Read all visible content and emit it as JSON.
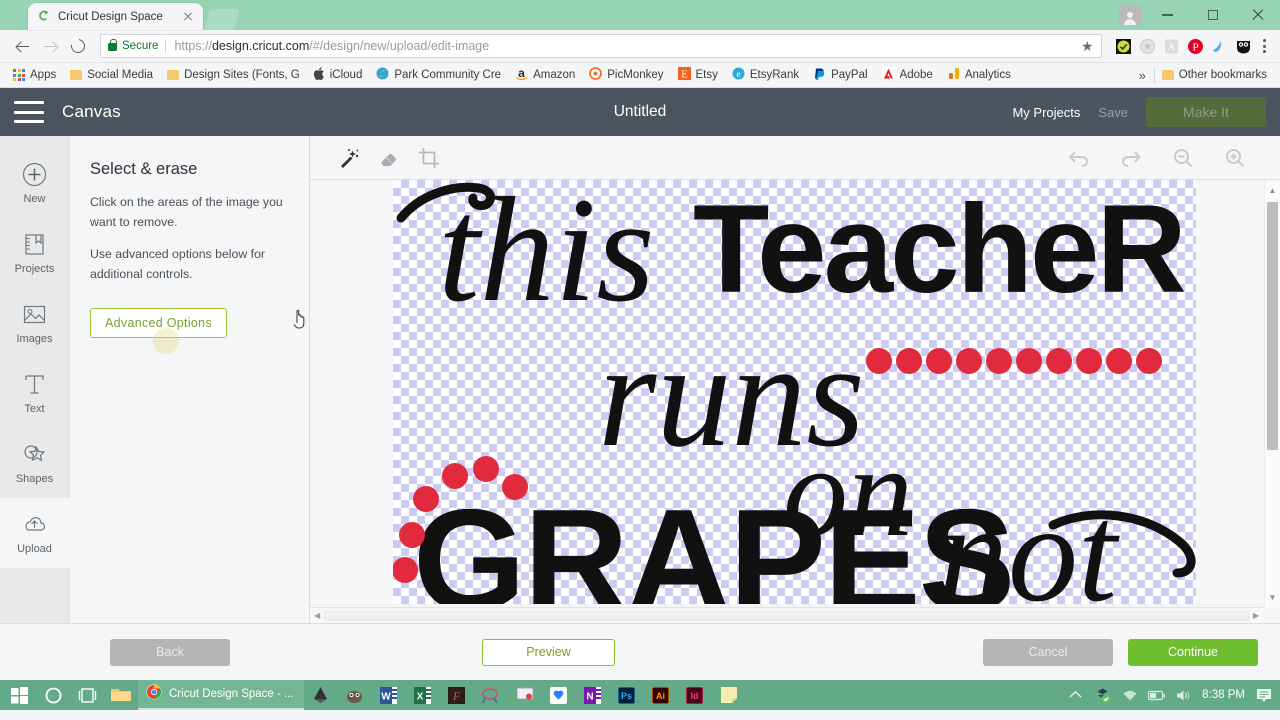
{
  "browser": {
    "tab": {
      "title": "Cricut Design Space",
      "favicon": "cricut-favicon",
      "close": "close-icon"
    },
    "new_tab_label": "",
    "window_controls": {
      "minimize": "minimize-icon",
      "maximize": "maximize-icon",
      "close": "close-icon"
    },
    "nav": {
      "back": "back-arrow-icon",
      "forward": "forward-arrow-icon",
      "reload": "reload-icon"
    },
    "address": {
      "security_label": "Secure",
      "url_prefix": "https://",
      "url_domain": "design.cricut.com",
      "url_path": "/#/design/new/upload/edit-image",
      "full_url": "https://design.cricut.com/#/design/new/upload/edit-image",
      "bookmark_star": "★"
    },
    "extensions": [
      "checkmark-extension-icon",
      "circle-extension-icon",
      "pdf-extension-icon",
      "pinterest-icon",
      "swoosh-extension-icon",
      "owl-extension-icon"
    ],
    "menu": "kebab-menu-icon",
    "bookmarks": [
      {
        "label": "Apps",
        "icon": "apps-grid-icon"
      },
      {
        "label": "Social Media",
        "icon": "folder-icon"
      },
      {
        "label": "Design Sites (Fonts, G",
        "icon": "folder-icon"
      },
      {
        "label": "iCloud",
        "icon": "apple-icon"
      },
      {
        "label": "Park Community Cre",
        "icon": "park-community-icon"
      },
      {
        "label": "Amazon",
        "icon": "amazon-icon"
      },
      {
        "label": "PicMonkey",
        "icon": "picmonkey-icon"
      },
      {
        "label": "Etsy",
        "icon": "etsy-icon"
      },
      {
        "label": "EtsyRank",
        "icon": "etsyrank-icon"
      },
      {
        "label": "PayPal",
        "icon": "paypal-icon"
      },
      {
        "label": "Adobe",
        "icon": "adobe-icon"
      },
      {
        "label": "Analytics",
        "icon": "analytics-icon"
      }
    ],
    "bookmarks_overflow": "»",
    "other_bookmarks": {
      "label": "Other bookmarks",
      "icon": "folder-icon"
    }
  },
  "app": {
    "menu_icon": "hamburger-menu-icon",
    "title": "Canvas",
    "document_title": "Untitled",
    "my_projects": "My Projects",
    "save": "Save",
    "make_it": "Make It"
  },
  "sidebar": {
    "items": [
      {
        "label": "New",
        "icon": "plus-circle-icon",
        "active": false
      },
      {
        "label": "Projects",
        "icon": "projects-book-icon",
        "active": false
      },
      {
        "label": "Images",
        "icon": "image-photo-icon",
        "active": false
      },
      {
        "label": "Text",
        "icon": "text-t-icon",
        "active": false
      },
      {
        "label": "Shapes",
        "icon": "shapes-star-icon",
        "active": false
      },
      {
        "label": "Upload",
        "icon": "upload-cloud-icon",
        "active": true
      }
    ]
  },
  "panel": {
    "heading": "Select & erase",
    "paragraph1": "Click on the areas of the image you want to remove.",
    "paragraph2": "Use advanced options below for additional controls.",
    "advanced_button": "Advanced Options"
  },
  "editor_toolbar": {
    "tools": [
      {
        "name": "magic-wand-icon",
        "active": true
      },
      {
        "name": "eraser-icon",
        "active": false
      },
      {
        "name": "crop-icon",
        "active": false
      }
    ],
    "right_tools": [
      {
        "name": "undo-icon"
      },
      {
        "name": "redo-icon"
      },
      {
        "name": "zoom-out-icon"
      },
      {
        "name": "zoom-in-icon"
      }
    ]
  },
  "artwork": {
    "description": "this TeacheR runs on GRAPES not",
    "lines": [
      "this TeacheR",
      "runs",
      "on",
      "GRAPES not"
    ],
    "dot_color": "#e12a3e",
    "ink_color": "#111111",
    "checker_color": "#ccccf0",
    "top_dot_row_count": 10,
    "arc_dot_count": 6
  },
  "scrollbars": {
    "vertical": {
      "up_arrow": "scroll-up-arrow-icon",
      "down_arrow": "scroll-down-arrow-icon"
    },
    "horizontal": {
      "left_arrow": "scroll-left-arrow-icon",
      "right_arrow": "scroll-right-arrow-icon"
    }
  },
  "footer": {
    "back": "Back",
    "preview": "Preview",
    "cancel": "Cancel",
    "continue": "Continue"
  },
  "taskbar": {
    "start": "windows-start-icon",
    "cortana": "cortana-circle-icon",
    "taskview": "task-view-icon",
    "explorer": "file-explorer-icon",
    "active_window": {
      "label": "Cricut Design Space - ...",
      "icon": "chrome-icon"
    },
    "pinned": [
      "inkscape-icon",
      "gimp-icon",
      "word-icon",
      "excel-icon",
      "fontforge-icon",
      "silhouette-studio-icon",
      "screen-recorder-icon",
      "dropbox-icon",
      "onenote-icon",
      "photoshop-icon",
      "illustrator-icon",
      "indesign-icon",
      "sticky-notes-icon"
    ],
    "tray": {
      "overflow": "tray-chevron-up-icon",
      "sync": "sync-status-icon",
      "wifi": "wifi-icon",
      "battery": "battery-icon",
      "volume": "volume-icon",
      "clock": "8:38 PM",
      "notifications": "notification-center-icon"
    }
  },
  "colors": {
    "browser_frame": "#97d3b5",
    "app_header": "#4b555f",
    "accent_green": "#6fbe2f",
    "outline_green": "#8cbf2c",
    "taskbar": "#63ab88",
    "red_dot": "#e12a3e"
  }
}
